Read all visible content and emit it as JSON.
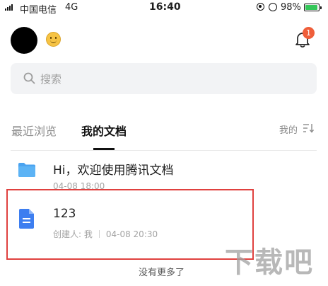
{
  "status_bar": {
    "carrier": "中国电信",
    "network": "4G",
    "time": "16:40",
    "battery_percent": "98%",
    "battery_level": 0.98,
    "battery_color": "#34c759"
  },
  "header": {
    "avatar_icon": "avatar",
    "emoji_icon": "smiley-face-icon",
    "bell_icon": "bell-icon",
    "notification_count": "1",
    "badge_color": "#ef5e3a"
  },
  "search": {
    "placeholder": "搜索",
    "icon": "search-icon"
  },
  "tabs": [
    {
      "label": "最近浏览",
      "active": false
    },
    {
      "label": "我的文档",
      "active": true
    }
  ],
  "sort": {
    "label": "我的",
    "icon": "sort-icon"
  },
  "files": [
    {
      "title": "Hi，欢迎使用腾讯文档",
      "meta": "04-08 18:00",
      "icon": "folder-icon",
      "icon_color": "#4aa3f0"
    },
    {
      "title": "123",
      "creator": "创建人: 我",
      "meta": "04-08 20:30",
      "icon": "doc-icon",
      "icon_color": "#3d7ef0"
    }
  ],
  "footer": {
    "no_more_text": "没有更多了"
  },
  "watermark": {
    "text": "下载吧"
  },
  "highlight_color": "#e0413f"
}
